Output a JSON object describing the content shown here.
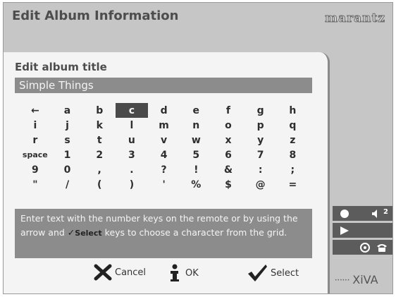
{
  "header": {
    "title": "Edit Album Information",
    "brand": "marantz"
  },
  "editor": {
    "field_label": "Edit album title",
    "title_value": "Simple Things",
    "selected_key": "c",
    "keys": [
      "←",
      "a",
      "b",
      "c",
      "d",
      "e",
      "f",
      "g",
      "h",
      "i",
      "j",
      "k",
      "l",
      "m",
      "n",
      "o",
      "p",
      "q",
      "r",
      "s",
      "t",
      "u",
      "v",
      "w",
      "x",
      "y",
      "z",
      "space",
      "1",
      "2",
      "3",
      "4",
      "5",
      "6",
      "7",
      "8",
      "9",
      "0",
      ",",
      ".",
      "?",
      "!",
      "&",
      ":",
      ";",
      "\"",
      "/",
      "(",
      ")",
      "'",
      "%",
      "$",
      "@",
      "="
    ],
    "help": {
      "text_before": "Enter text with the number keys on the remote or by using the arrow and ",
      "check_glyph": "✓",
      "select_word": "Select",
      "text_after": " keys to choose a character from the grid."
    }
  },
  "buttons": {
    "cancel": {
      "label": "Cancel",
      "icon": "x-icon"
    },
    "ok": {
      "label": "OK",
      "icon": "info-icon"
    },
    "select": {
      "label": "Select",
      "icon": "checkmark-icon"
    }
  },
  "status": {
    "volume": "2"
  },
  "footer": {
    "logo": "XiVA"
  },
  "colors": {
    "background": "#c6c6c6",
    "panel": "#f4f4f4",
    "highlight": "#8c8c8c",
    "selected_key": "#4a4a4a"
  }
}
